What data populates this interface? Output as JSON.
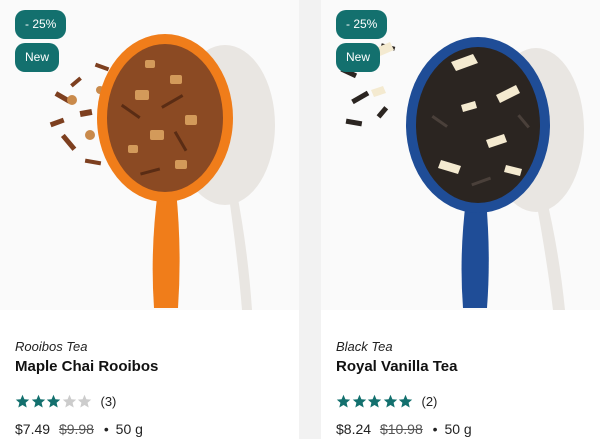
{
  "products": [
    {
      "badges": {
        "discount": "- 25%",
        "new": "New"
      },
      "category": "Rooibos Tea",
      "name": "Maple Chai Rooibos",
      "rating": {
        "score": 3,
        "max": 5,
        "reviews": "(3)"
      },
      "price": {
        "current": "$7.49",
        "original": "$9.98",
        "separator": "•",
        "weight": "50 g"
      },
      "colors": {
        "spoon": "#f07d1a",
        "tea": "#8b4a23"
      }
    },
    {
      "badges": {
        "discount": "- 25%",
        "new": "New"
      },
      "category": "Black Tea",
      "name": "Royal Vanilla Tea",
      "rating": {
        "score": 5,
        "max": 5,
        "reviews": "(2)"
      },
      "price": {
        "current": "$8.24",
        "original": "$10.98",
        "separator": "•",
        "weight": "50 g"
      },
      "colors": {
        "spoon": "#1f4d97",
        "tea": "#2b2521"
      }
    }
  ],
  "theme": {
    "badge": "#13706e",
    "star_on": "#13706e",
    "star_off": "#cccccc"
  }
}
